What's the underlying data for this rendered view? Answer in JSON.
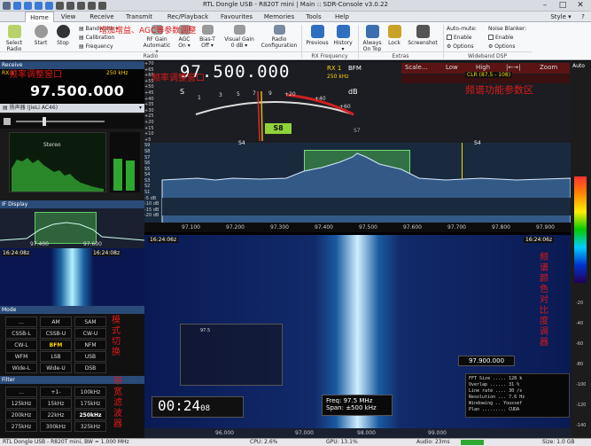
{
  "window": {
    "title": "RTL Dongle USB - R820T mini | Main :: SDR-Console v3.0.22",
    "style_label": "Style"
  },
  "tabs": [
    "Home",
    "View",
    "Receive",
    "Transmit",
    "Rec/Playback",
    "Favourites",
    "Memories",
    "Tools",
    "Help"
  ],
  "ribbon": {
    "select_radio": "Select Radio",
    "start": "Start",
    "stop": "Stop",
    "bandwidth": "Bandwidth",
    "calibration": "Calibration",
    "frequency": "Frequency",
    "rf_gain": "RF Gain",
    "rf_gain_val": "Automatic",
    "agc": "AGC",
    "agc_val": "On",
    "bias_t": "Bias-T",
    "bias_t_val": "Off",
    "visual_gain": "Visual Gain",
    "visual_gain_val": "0 dB",
    "radio_config": "Radio Configuration",
    "previous": "Previous",
    "history": "History",
    "always_on_top": "Always On Top",
    "lock": "Lock",
    "screenshot": "Screenshot",
    "auto_mute": "Auto-mute:",
    "enable": "Enable",
    "options": "Options",
    "noise_blanker": "Noise Blanker:",
    "enable2": "Enable",
    "options2": "Options",
    "grp_radio": "Radio",
    "grp_rx": "RX Frequency",
    "grp_extras": "Extras",
    "grp_dsp": "Wideband DSP",
    "annot": "增加增益、AGC等参数调整"
  },
  "left": {
    "receive": "Receive",
    "rx_label": "RX 1",
    "rate": "250 kHz",
    "freq": "97.500.000",
    "annot_freq": "频率调整窗口",
    "speaker": "扬声器 (JieLi AC46)",
    "stereo": "Stereo",
    "if_display": "IF Display",
    "if_ticks": [
      "97.400",
      "97.600"
    ],
    "time_a": "16:24:08z",
    "time_b": "16:24:08z",
    "mode_title": "Mode",
    "modes": [
      "...",
      "AM",
      "SAM",
      "CSSB-L",
      "CSSB-U",
      "CW-U",
      "CW-L",
      "BFM",
      "NFM",
      "WFM",
      "LSB",
      "USB",
      "Wide-L",
      "Wide-U",
      "DSB"
    ],
    "annot_mode": [
      "模",
      "式",
      "切",
      "换"
    ],
    "filter_title": "Filter",
    "filters": [
      "...",
      "+1-",
      "100kHz",
      "125kHz",
      "15kHz",
      "175kHz",
      "200kHz",
      "22kHz",
      "250kHz",
      "275kHz",
      "300kHz",
      "325kHz"
    ],
    "annot_filter": [
      "带",
      "宽",
      "滤",
      "波",
      "器"
    ]
  },
  "spectrum": {
    "freq": "97.500.000",
    "rx": "RX 1",
    "mode": "BFM",
    "bw": "250 kHz",
    "toolbar": [
      "Scale...",
      "Low",
      "High",
      "Zoom"
    ],
    "smeter": {
      "s": "S",
      "db": "dB",
      "scale": [
        "1",
        "3",
        "5",
        "7",
        "9",
        "+20",
        "+40",
        "+60"
      ],
      "value": "S8"
    },
    "dbl": [
      "+70",
      "+65",
      "+60",
      "+55",
      "+50",
      "+45",
      "+40",
      "+35",
      "+30",
      "+25",
      "+20",
      "+15",
      "+10",
      "+5",
      "S9",
      "S8",
      "S7",
      "S6",
      "S5",
      "S4",
      "S3",
      "S2",
      "S1",
      "-5 dB",
      "-10 dB",
      "-15 dB",
      "-20 dB"
    ],
    "ticks": [
      "97.100",
      "97.200",
      "97.300",
      "97.400",
      "97.500",
      "97.600",
      "97.700",
      "97.800",
      "97.900"
    ],
    "markers": [
      "S4",
      "S7",
      "S4"
    ],
    "clr": "CLR (87.5 - 108)",
    "annot": "频谱功能参数区",
    "annot_left": "频率调整窗口"
  },
  "waterfall": {
    "time": "16:24:06z",
    "time2": "16:24:06z",
    "clock": "00:24",
    "clock_s": "08",
    "freq_label": "Freq: 97.5 MHz",
    "span": "Span: ±500 kHz",
    "marker": "97.900.000",
    "fft": [
      "FFT Size ..... 128 k",
      "Overlap ...... 31 %",
      "Line rate .... 30 /s",
      "Resolution ... 7.6 Hz",
      "Windowing .. Youssef",
      "Plan ......... CUDA"
    ],
    "ticks": [
      "96.000",
      "97.000",
      "98.000",
      "99.000"
    ],
    "annot": [
      "频",
      "谱",
      "颜",
      "色",
      "对",
      "比",
      "度",
      "调",
      "器"
    ],
    "popup": "97.5"
  },
  "right": {
    "auto": "Auto",
    "ticks": [
      "-20",
      "-40",
      "-60",
      "-80",
      "-100",
      "-120",
      "-140"
    ]
  },
  "status": {
    "device": "RTL Dongle USB - R820T mini, BW = 1.000 MHz",
    "cpu": "CPU: 2.6%",
    "gpu": "GPU: 13.1%",
    "audio": "Audio: 23ms",
    "size": "Size: 1.0 GB"
  }
}
